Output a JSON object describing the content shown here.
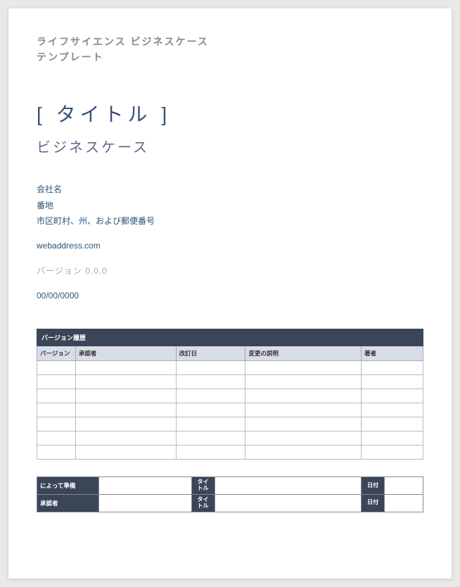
{
  "header": {
    "line1": "ライフサイエンス ビジネスケース",
    "line2": "テンプレート"
  },
  "title": "[ タイトル ]",
  "subtitle": "ビジネスケース",
  "company": {
    "name": "会社名",
    "street": "番地",
    "cityStateZip": "市区町村、州、および郵便番号"
  },
  "webaddress": "webaddress.com",
  "version_label": "バージョン 0.0.0",
  "date": "00/00/0000",
  "version_history": {
    "title": "バージョン履歴",
    "columns": {
      "version": "バージョン",
      "approver": "承認者",
      "rev_date": "改訂日",
      "change_desc": "変更の説明",
      "author": "著者"
    },
    "rows": [
      {
        "version": "",
        "approver": "",
        "rev_date": "",
        "change_desc": "",
        "author": ""
      },
      {
        "version": "",
        "approver": "",
        "rev_date": "",
        "change_desc": "",
        "author": ""
      },
      {
        "version": "",
        "approver": "",
        "rev_date": "",
        "change_desc": "",
        "author": ""
      },
      {
        "version": "",
        "approver": "",
        "rev_date": "",
        "change_desc": "",
        "author": ""
      },
      {
        "version": "",
        "approver": "",
        "rev_date": "",
        "change_desc": "",
        "author": ""
      },
      {
        "version": "",
        "approver": "",
        "rev_date": "",
        "change_desc": "",
        "author": ""
      },
      {
        "version": "",
        "approver": "",
        "rev_date": "",
        "change_desc": "",
        "author": ""
      }
    ]
  },
  "signoff": {
    "prepared_by": "によって準備",
    "approver": "承認者",
    "title_label": "タイトル",
    "date_label": "日付"
  }
}
